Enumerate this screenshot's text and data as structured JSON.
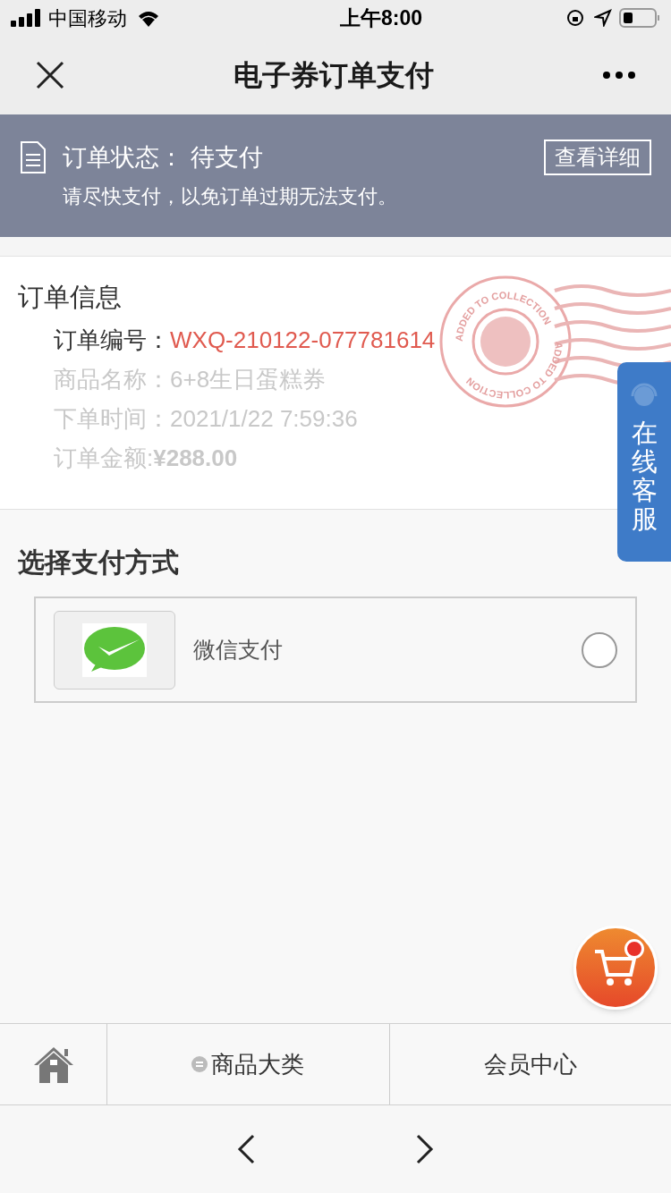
{
  "status_bar": {
    "carrier": "中国移动",
    "time": "上午8:00"
  },
  "nav": {
    "title": "电子券订单支付"
  },
  "banner": {
    "status_label": "订单状态：",
    "status_value": "待支付",
    "details_button": "查看详细",
    "message": "请尽快支付，以免订单过期无法支付。"
  },
  "order_info": {
    "title": "订单信息",
    "rows": [
      {
        "label": "订单编号：",
        "value": "WXQ-210122-077781614",
        "kind": "highlight"
      },
      {
        "label": "商品名称：",
        "value": "6+8生日蛋糕券",
        "kind": "muted"
      },
      {
        "label": "下单时间：",
        "value": "2021/1/22 7:59:36",
        "kind": "muted"
      },
      {
        "label": "订单金额:",
        "value": "¥288.00",
        "kind": "amount"
      }
    ],
    "stamp": {
      "texts": [
        "ADDED TO COLLECTION",
        "ADDED TO COLLECTION"
      ]
    }
  },
  "payment": {
    "title": "选择支付方式",
    "options": [
      {
        "label": "微信支付",
        "selected": false
      }
    ]
  },
  "service_tab": {
    "label": "在线客服"
  },
  "cart_button": {
    "has_badge": true
  },
  "bottom_nav": {
    "items": [
      {
        "label": "商品大类"
      },
      {
        "label": "会员中心"
      }
    ]
  }
}
